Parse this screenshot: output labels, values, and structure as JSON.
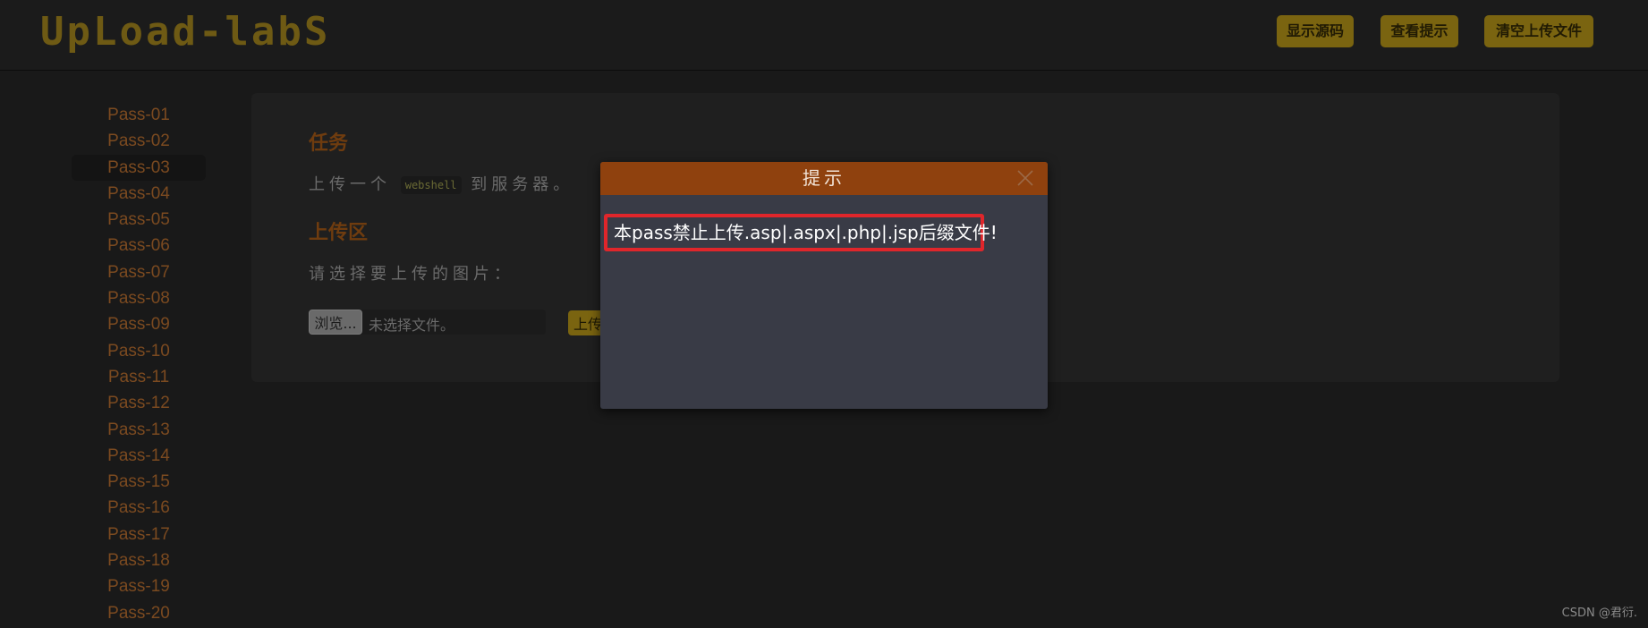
{
  "header": {
    "logo_text": "UpLoad-labS",
    "buttons": {
      "show_source": "显示源码",
      "view_hint": "查看提示",
      "clear_uploads": "清空上传文件"
    }
  },
  "sidebar": {
    "active_index": 2,
    "items": [
      {
        "label": "Pass-01"
      },
      {
        "label": "Pass-02"
      },
      {
        "label": "Pass-03"
      },
      {
        "label": "Pass-04"
      },
      {
        "label": "Pass-05"
      },
      {
        "label": "Pass-06"
      },
      {
        "label": "Pass-07"
      },
      {
        "label": "Pass-08"
      },
      {
        "label": "Pass-09"
      },
      {
        "label": "Pass-10"
      },
      {
        "label": "Pass-11"
      },
      {
        "label": "Pass-12"
      },
      {
        "label": "Pass-13"
      },
      {
        "label": "Pass-14"
      },
      {
        "label": "Pass-15"
      },
      {
        "label": "Pass-16"
      },
      {
        "label": "Pass-17"
      },
      {
        "label": "Pass-18"
      },
      {
        "label": "Pass-19"
      },
      {
        "label": "Pass-20"
      }
    ]
  },
  "main": {
    "task": {
      "title": "任务",
      "text_before": "上传一个",
      "code": "webshell",
      "text_after": "到服务器。"
    },
    "upload_section": {
      "title": "上传区",
      "choose_label": "请选择要上传的图片：",
      "browse_button": "浏览...",
      "file_status": "未选择文件。",
      "upload_button": "上传"
    }
  },
  "dialog": {
    "title": "提示",
    "message": "本pass禁止上传.asp|.aspx|.php|.jsp后缀文件!",
    "close_icon": "close-icon"
  },
  "watermark": "CSDN @君衍.",
  "colors": {
    "background": "#191919",
    "accent_gold": "#7a6410",
    "accent_orange": "#8f410e",
    "highlight_red": "#e0262b"
  }
}
